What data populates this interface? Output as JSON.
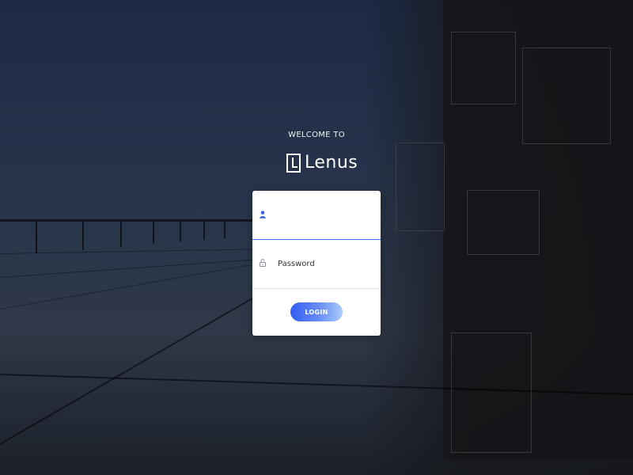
{
  "header": {
    "welcome_text": "WELCOME TO",
    "brand_name": "Lenus",
    "logo_icon": "lenus-logo-icon"
  },
  "login_form": {
    "username": {
      "value": "",
      "placeholder": "",
      "icon": "user-icon",
      "icon_color": "#2f5cf1"
    },
    "password": {
      "value": "",
      "placeholder": "Password",
      "icon": "lock-icon",
      "icon_color": "#8a8f99"
    },
    "login_label": "LOGIN"
  },
  "colors": {
    "accent": "#2f5cf1",
    "accent_light": "#a9cdf8",
    "card_background": "#ffffff",
    "background_dark": "#1d2a45"
  }
}
